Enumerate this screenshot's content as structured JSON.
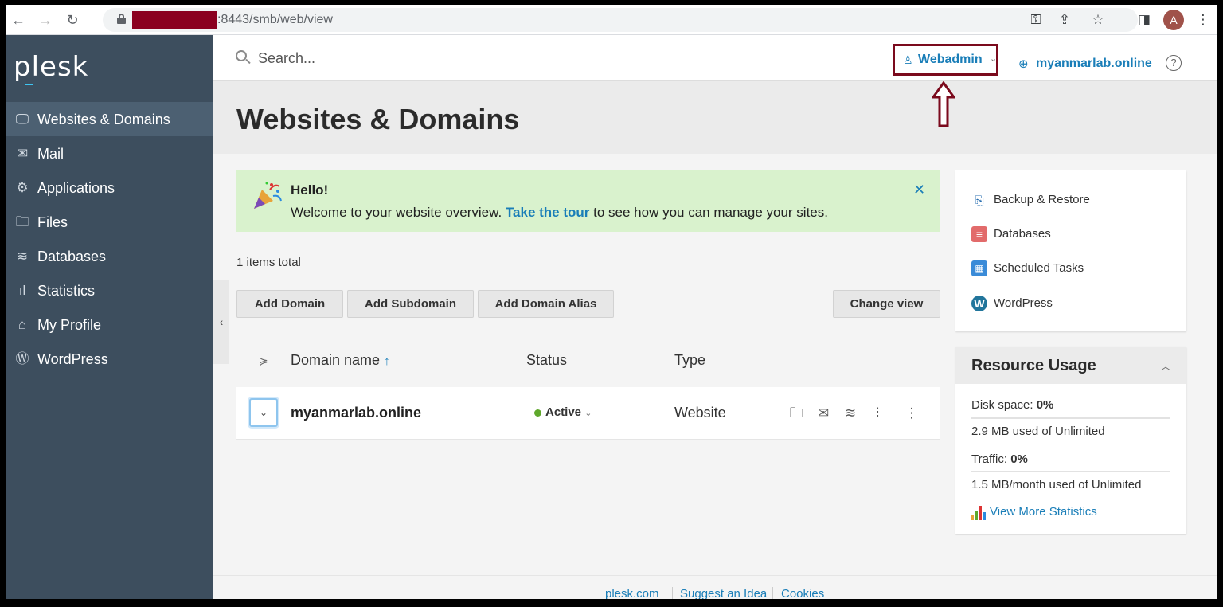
{
  "browser": {
    "url_text": ":8443/smb/web/view",
    "avatar_letter": "A"
  },
  "sidebar": {
    "logo": "plesk",
    "items": [
      {
        "label": "Websites & Domains",
        "icon": "monitor-icon",
        "active": true
      },
      {
        "label": "Mail",
        "icon": "envelope-icon"
      },
      {
        "label": "Applications",
        "icon": "gear-icon"
      },
      {
        "label": "Files",
        "icon": "folder-icon"
      },
      {
        "label": "Databases",
        "icon": "database-icon"
      },
      {
        "label": "Statistics",
        "icon": "bar-chart-icon"
      },
      {
        "label": "My Profile",
        "icon": "profile-icon"
      },
      {
        "label": "WordPress",
        "icon": "wordpress-icon"
      }
    ]
  },
  "header": {
    "search_placeholder": "Search...",
    "user_label": "Webadmin",
    "domain_label": "myanmarlab.online"
  },
  "main": {
    "title": "Websites & Domains",
    "banner": {
      "hello": "Hello!",
      "text_before": "Welcome to your website overview. ",
      "tour_link": "Take the tour",
      "text_after": " to see how you can manage your sites."
    },
    "items_total": "1 items total",
    "buttons": {
      "add_domain": "Add Domain",
      "add_subdomain": "Add Subdomain",
      "add_alias": "Add Domain Alias",
      "change_view": "Change view"
    },
    "columns": {
      "domain": "Domain name",
      "sort_arrow": "↑",
      "status": "Status",
      "type": "Type"
    },
    "rows": [
      {
        "domain": "myanmarlab.online",
        "status": "Active",
        "type": "Website"
      }
    ]
  },
  "right": {
    "links": [
      {
        "label": "Backup & Restore",
        "icon": "backup-icon"
      },
      {
        "label": "Databases",
        "icon": "database-icon"
      },
      {
        "label": "Scheduled Tasks",
        "icon": "calendar-icon"
      },
      {
        "label": "WordPress",
        "icon": "wordpress-icon"
      }
    ],
    "resource": {
      "title": "Resource Usage",
      "disk_label": "Disk space: ",
      "disk_value": "0%",
      "disk_detail": "2.9 MB used of Unlimited",
      "traffic_label": "Traffic: ",
      "traffic_value": "0%",
      "traffic_detail": "1.5 MB/month used of Unlimited",
      "stats_link": "View More Statistics"
    }
  },
  "footer": {
    "links": [
      "plesk.com",
      "Suggest an Idea",
      "Cookies"
    ]
  },
  "colors": {
    "sidebar": "#3d4e5e",
    "link": "#1a7eb8",
    "highlight_box": "#7b0a1d",
    "banner": "#d9f2cd",
    "active_status": "#5fa82c"
  }
}
